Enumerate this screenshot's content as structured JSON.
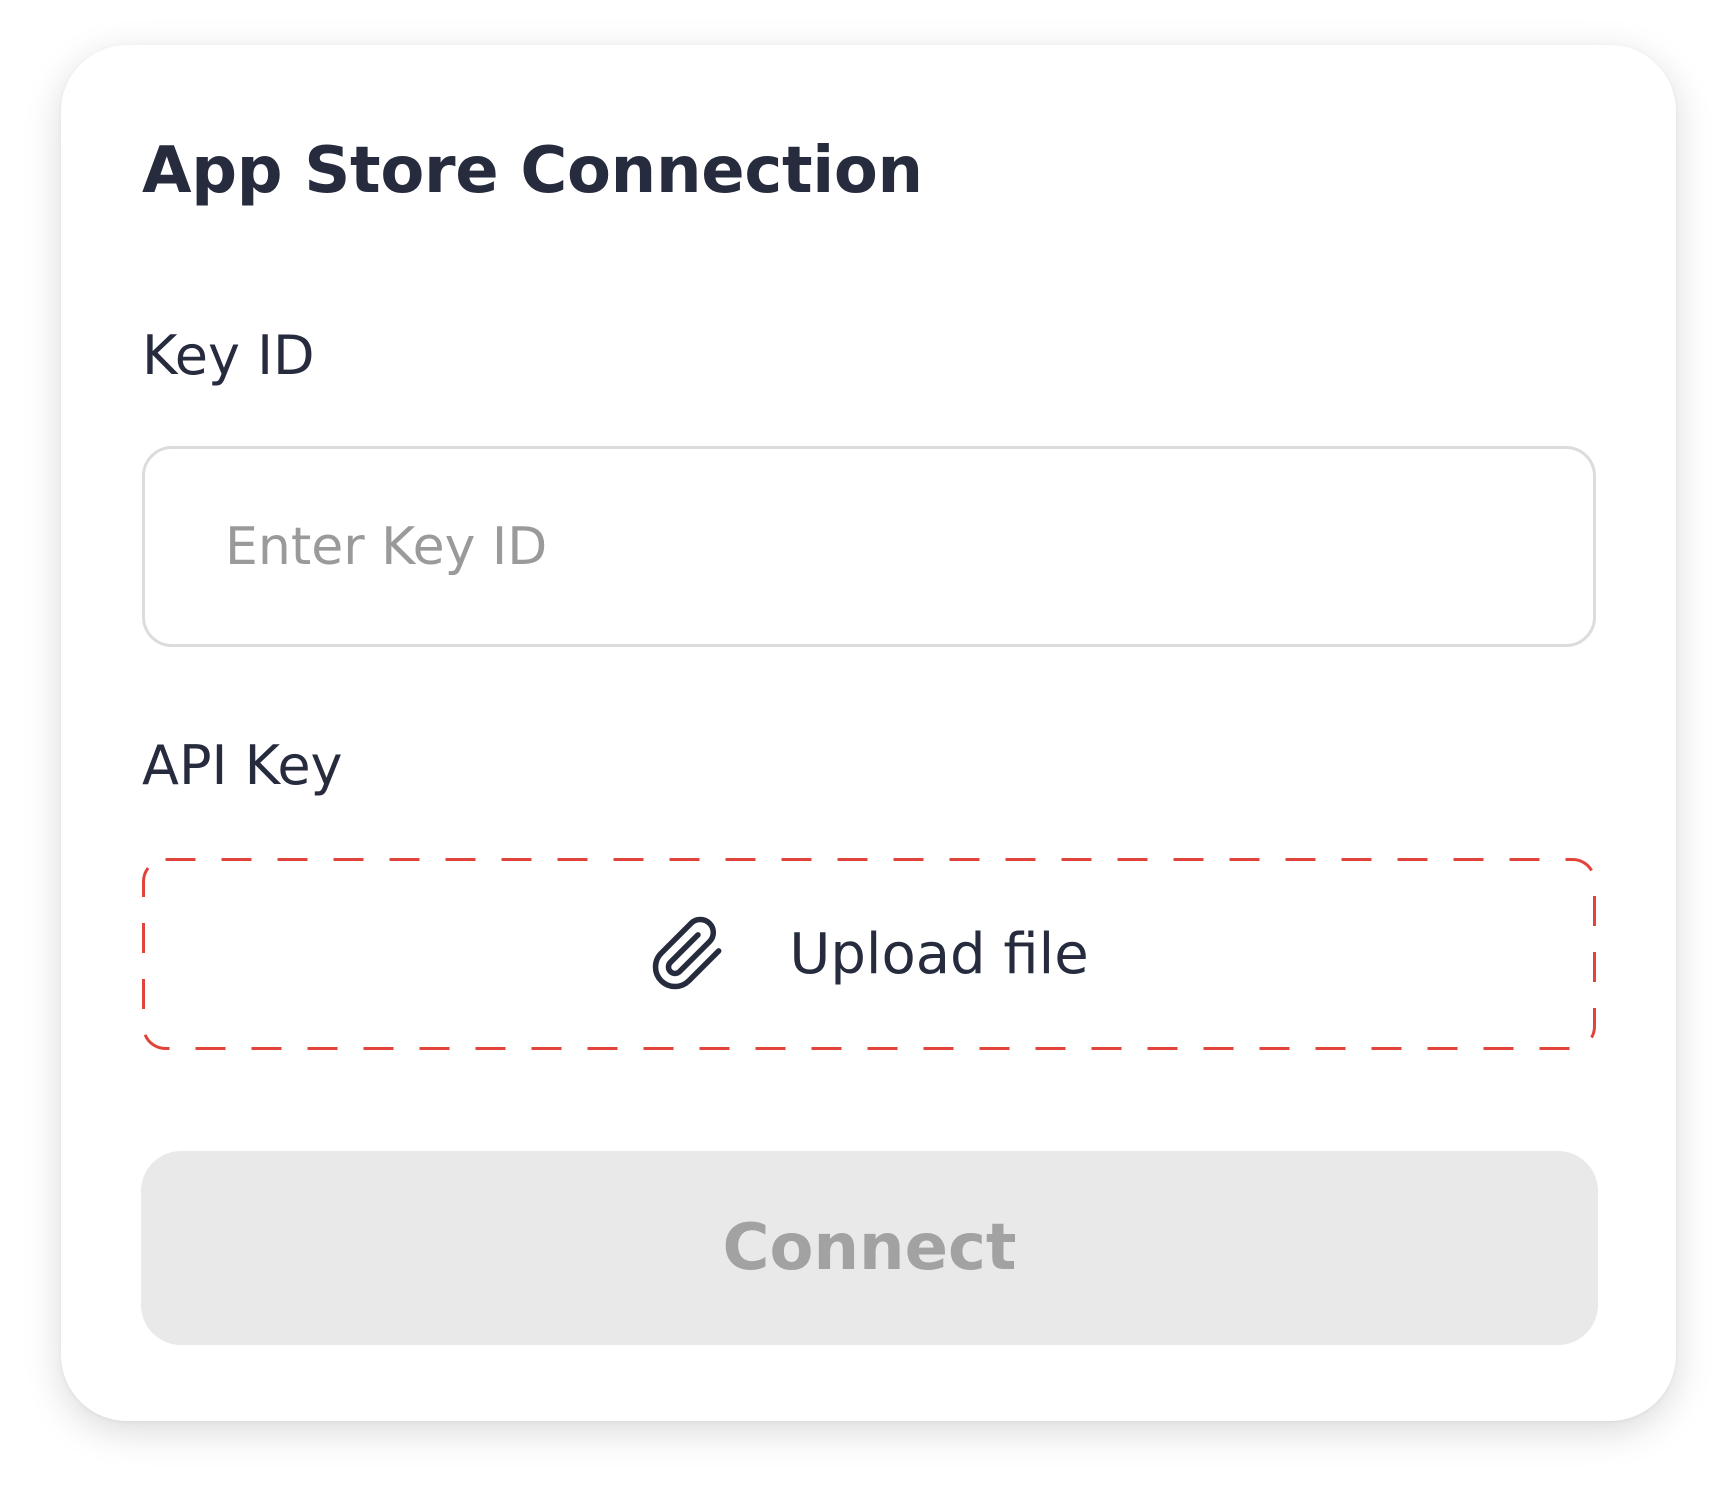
{
  "card": {
    "title": "App Store Connection"
  },
  "key_id": {
    "label": "Key ID",
    "placeholder": "Enter Key ID",
    "value": ""
  },
  "api_key": {
    "label": "API Key",
    "upload_label": "Upload file",
    "icon": "paperclip-icon"
  },
  "connect": {
    "label": "Connect",
    "disabled": true
  },
  "colors": {
    "text": "#262b3d",
    "placeholder": "#9a9a9a",
    "input_border": "#dcdcdc",
    "upload_border": "#e0443a",
    "button_bg_disabled": "#e9e9e9",
    "button_text_disabled": "#a2a2a2"
  }
}
